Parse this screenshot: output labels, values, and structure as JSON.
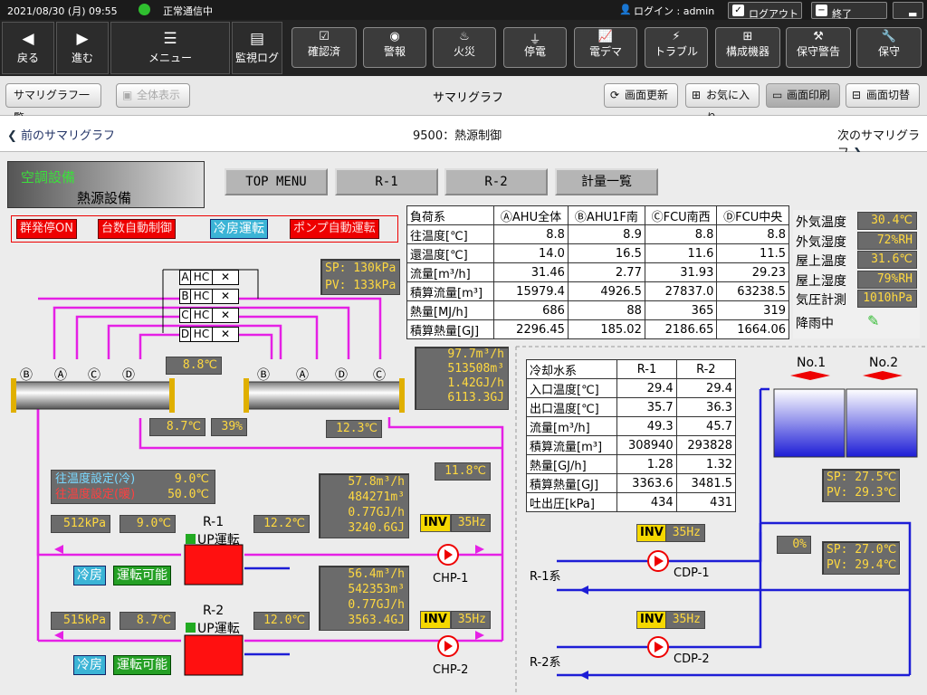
{
  "status": {
    "datetime": "2021/08/30 (月) 09:55",
    "comm": "正常通信中",
    "login": "ログイン : admin",
    "logout": "ログアウト",
    "exit": "終了"
  },
  "nav": {
    "back": "戻る",
    "forward": "進む",
    "menu": "メニュー",
    "monitor_log": "監視ログ",
    "alarms": [
      "確認済",
      "警報",
      "火災",
      "停電",
      "電デマ",
      "トラブル",
      "構成機器",
      "保守警告",
      "保守"
    ]
  },
  "toolbar": {
    "list": "サマリグラフ一覧",
    "show_all": "全体表示",
    "title": "サマリグラフ",
    "refresh": "画面更新",
    "favorite": "お気に入り",
    "print": "画面印刷",
    "switch": "画面切替"
  },
  "pager": {
    "prev": "前のサマリグラフ",
    "title": "9500：熱源制御",
    "next": "次のサマリグラフ"
  },
  "header": {
    "system": "空調設備",
    "subsystem": "熱源設備",
    "buttons": [
      "TOP MENU",
      "R-1",
      "R-2",
      "計量一覧"
    ]
  },
  "modes": {
    "group_stop": "群発停ON",
    "count_auto": "台数自動制御",
    "cooling": "冷房運転",
    "pump_auto": "ポンプ自動運転"
  },
  "load_table": {
    "headers": [
      "負荷系",
      "ⒶAHU全体",
      "ⒷAHU1F南",
      "ⒸFCU南西",
      "ⒹFCU中央"
    ],
    "rows": [
      [
        "往温度[℃]",
        "8.8",
        "8.9",
        "8.8",
        "8.8"
      ],
      [
        "還温度[℃]",
        "14.0",
        "16.5",
        "11.6",
        "11.5"
      ],
      [
        "流量[m³/h]",
        "31.46",
        "2.77",
        "31.93",
        "29.23"
      ],
      [
        "積算流量[m³]",
        "15979.4",
        "4926.5",
        "27837.0",
        "63238.5"
      ],
      [
        "熱量[MJ/h]",
        "686",
        "88",
        "365",
        "319"
      ],
      [
        "積算熱量[GJ]",
        "2296.45",
        "185.02",
        "2186.65",
        "1664.06"
      ]
    ]
  },
  "weather": {
    "rows": [
      [
        "外気温度",
        "30.4℃"
      ],
      [
        "外気湿度",
        "72%RH"
      ],
      [
        "屋上温度",
        "31.6℃"
      ],
      [
        "屋上湿度",
        "79%RH"
      ],
      [
        "気圧計測",
        "1010hPa"
      ]
    ],
    "rain": "降雨中"
  },
  "cooling_table": {
    "headers": [
      "冷却水系",
      "R-1",
      "R-2"
    ],
    "rows": [
      [
        "入口温度[℃]",
        "29.4",
        "29.4"
      ],
      [
        "出口温度[℃]",
        "35.7",
        "36.3"
      ],
      [
        "流量[m³/h]",
        "49.3",
        "45.7"
      ],
      [
        "積算流量[m³]",
        "308940",
        "293828"
      ],
      [
        "熱量[GJ/h]",
        "1.28",
        "1.32"
      ],
      [
        "積算熱量[GJ]",
        "3363.6",
        "3481.5"
      ],
      [
        "吐出圧[kPa]",
        "434",
        "431"
      ]
    ]
  },
  "diagram": {
    "header_sp": "SP: 130kPa",
    "header_pv": "PV: 133kPa",
    "hc": [
      "A",
      "B",
      "C",
      "D"
    ],
    "hc_text": "HC",
    "sup_header_temp": "8.8℃",
    "ret_totals": [
      "97.7m³/h",
      "513508m³",
      "1.42GJ/h",
      "6113.3GJ"
    ],
    "bypass_temp": "8.7℃",
    "bypass_pct": "39%",
    "ret_temp": "12.3℃",
    "common_ret": "11.8℃",
    "set_cool_label": "往温度設定(冷)",
    "set_cool": "9.0℃",
    "set_heat_label": "往温度設定(暖)",
    "set_heat": "50.0℃",
    "r1": {
      "name": "R-1",
      "run": "UP運転",
      "kpa": "512kPa",
      "sup": "9.0℃",
      "ret": "12.2℃",
      "flow": "57.8m³/h",
      "vol": "484271m³",
      "heat": "0.77GJ/h",
      "total": "3240.6GJ",
      "mode": "冷房",
      "ready": "運転可能",
      "inv": "INV",
      "hz": "35Hz",
      "pump": "CHP-1"
    },
    "r2": {
      "name": "R-2",
      "run": "UP運転",
      "kpa": "515kPa",
      "sup": "8.7℃",
      "ret": "12.0℃",
      "flow": "56.4m³/h",
      "vol": "542353m³",
      "heat": "0.77GJ/h",
      "total": "3563.4GJ",
      "mode": "冷房",
      "ready": "運転可能",
      "inv": "INV",
      "hz": "35Hz",
      "pump": "CHP-2"
    },
    "towers": [
      "No.1",
      "No.2"
    ],
    "tower_sp1": "SP: 27.5℃",
    "tower_pv1": "PV: 29.3℃",
    "tower_sp2": "SP: 27.0℃",
    "tower_pv2": "PV: 29.4℃",
    "valve_pct": "0%",
    "cdp1": {
      "inv": "INV",
      "hz": "35Hz",
      "pump": "CDP-1",
      "sys": "R-1系"
    },
    "cdp2": {
      "inv": "INV",
      "hz": "35Hz",
      "pump": "CDP-2",
      "sys": "R-2系"
    },
    "branch_labels": [
      "Ⓑ",
      "Ⓐ",
      "Ⓒ",
      "Ⓓ"
    ],
    "branch_labels_right": [
      "Ⓑ",
      "Ⓐ",
      "Ⓓ",
      "Ⓒ"
    ]
  }
}
